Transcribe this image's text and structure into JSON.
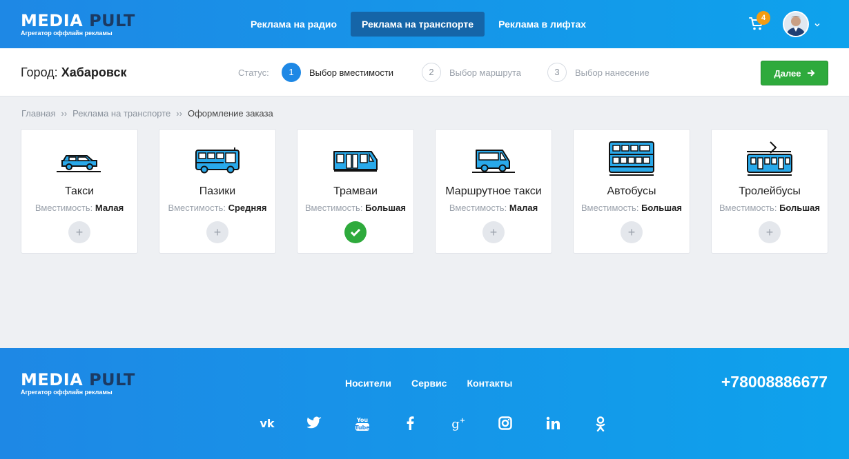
{
  "brand": {
    "name_a": "MEDIA",
    "name_b": "PULT",
    "tagline": "Агрегатор оффлайн рекламы",
    "color_primary": "#1e88e5",
    "color_dark": "#1b3a63"
  },
  "nav": [
    {
      "label": "Реклама на радио",
      "active": false
    },
    {
      "label": "Реклама на транспорте",
      "active": true
    },
    {
      "label": "Реклама в лифтах",
      "active": false
    }
  ],
  "cart": {
    "count": "4",
    "icon": "cart-icon"
  },
  "user": {
    "avatar": "avatar-photo",
    "menu_icon": "chevron-down-icon"
  },
  "status": {
    "city_label": "Город:",
    "city_value": "Хабаровск",
    "label": "Статус:",
    "steps": [
      {
        "num": "1",
        "label": "Выбор вместимости",
        "active": true
      },
      {
        "num": "2",
        "label": "Выбор маршрута",
        "active": false
      },
      {
        "num": "3",
        "label": "Выбор нанесение",
        "active": false
      }
    ],
    "next_label": "Далее"
  },
  "breadcrumb": {
    "items": [
      "Главная",
      "Реклама на транспорте",
      "Оформление заказа"
    ],
    "separator": "››"
  },
  "cards": [
    {
      "title": "Такси",
      "cap_label": "Вместимость:",
      "cap_value": "Малая",
      "icon": "taxi-icon",
      "selected": false
    },
    {
      "title": "Пазики",
      "cap_label": "Вместимость:",
      "cap_value": "Средняя",
      "icon": "minibus-icon",
      "selected": false
    },
    {
      "title": "Трамваи",
      "cap_label": "Вместимость:",
      "cap_value": "Большая",
      "icon": "tram-icon",
      "selected": true
    },
    {
      "title": "Маршрутное такси",
      "cap_label": "Вместимость:",
      "cap_value": "Малая",
      "icon": "van-icon",
      "selected": false
    },
    {
      "title": "Автобусы",
      "cap_label": "Вместимость:",
      "cap_value": "Большая",
      "icon": "double-decker-bus-icon",
      "selected": false
    },
    {
      "title": "Тролейбусы",
      "cap_label": "Вместимость:",
      "cap_value": "Большая",
      "icon": "trolleybus-icon",
      "selected": false
    }
  ],
  "footer": {
    "links": [
      "Носители",
      "Сервис",
      "Контакты"
    ],
    "phone": "+78008886677",
    "social": [
      "vk-icon",
      "twitter-icon",
      "youtube-icon",
      "facebook-icon",
      "google-plus-icon",
      "instagram-icon",
      "linkedin-icon",
      "odnoklassniki-icon"
    ]
  }
}
